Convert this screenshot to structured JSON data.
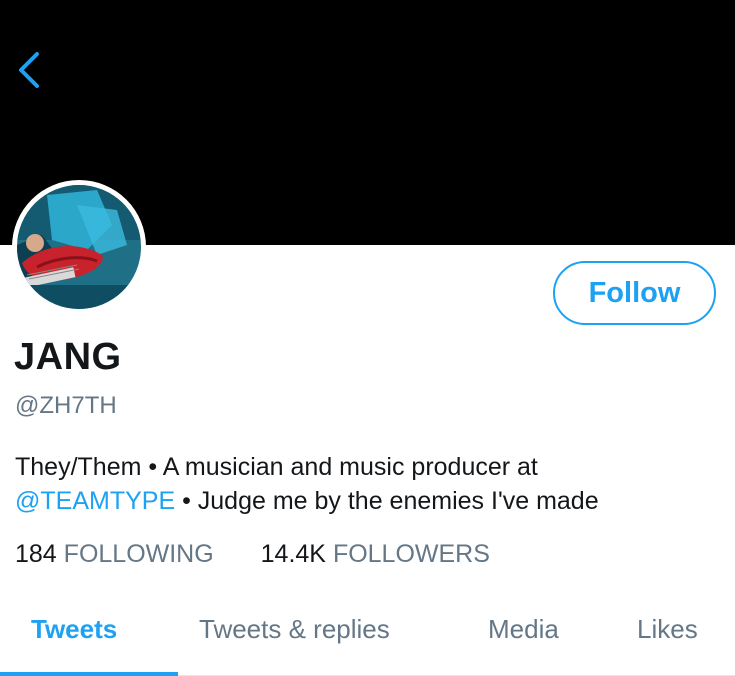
{
  "header": {
    "back_icon": "chevron-left-icon"
  },
  "profile": {
    "display_name": "JANG",
    "handle": "@ZH7TH",
    "follow_label": "Follow",
    "bio": {
      "part1": "They/Them • A musician and music producer at",
      "mention": "@TEAMTYPE",
      "part2": " • Judge me by the enemies I've made"
    },
    "stats": {
      "following_count": "184",
      "following_label": "FOLLOWING",
      "followers_count": "14.4K",
      "followers_label": "FOLLOWERS"
    }
  },
  "tabs": [
    {
      "label": "Tweets",
      "active": true
    },
    {
      "label": "Tweets & replies",
      "active": false
    },
    {
      "label": "Media",
      "active": false
    },
    {
      "label": "Likes",
      "active": false
    }
  ],
  "colors": {
    "accent": "#1da1f2",
    "banner": "#000000",
    "secondary_text": "#657786",
    "primary_text": "#14171a"
  }
}
